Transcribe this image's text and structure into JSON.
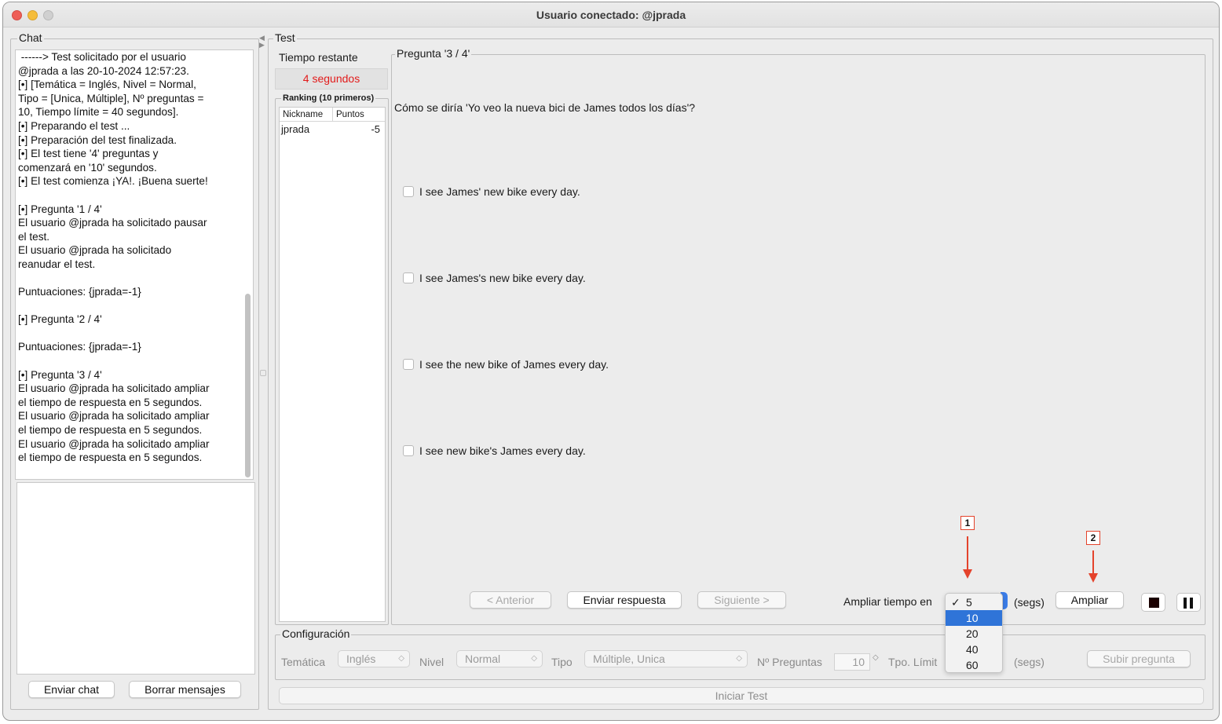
{
  "window": {
    "title": "Usuario conectado: @jprada"
  },
  "chat": {
    "legend": "Chat",
    "log": [
      " ------> Test solicitado por el usuario",
      "@jprada a las 20-10-2024 12:57:23.",
      "[•] [Temática = Inglés, Nivel = Normal,",
      "Tipo = [Unica, Múltiple], Nº preguntas =",
      "10, Tiempo límite = 40 segundos].",
      "[•] Preparando el test ...",
      "[•] Preparación del test finalizada.",
      "[•] El test tiene '4' preguntas y",
      "comenzará en '10' segundos.",
      "[•] El test comienza ¡YA!. ¡Buena suerte!",
      "",
      "[•] Pregunta '1 / 4'",
      "El usuario @jprada ha solicitado pausar",
      "el test.",
      "El usuario @jprada ha solicitado",
      "reanudar el test.",
      "",
      "Puntuaciones: {jprada=-1}",
      "",
      "[•] Pregunta '2 / 4'",
      "",
      "Puntuaciones: {jprada=-1}",
      "",
      "[•] Pregunta '3 / 4'",
      "El usuario @jprada ha solicitado ampliar",
      "el tiempo de respuesta en 5 segundos.",
      "El usuario @jprada ha solicitado ampliar",
      "el tiempo de respuesta en 5 segundos.",
      "El usuario @jprada ha solicitado ampliar",
      "el tiempo de respuesta en 5 segundos."
    ],
    "send_button": "Enviar chat",
    "clear_button": "Borrar mensajes"
  },
  "test": {
    "legend": "Test",
    "time": {
      "label": "Tiempo restante",
      "value": "4 segundos"
    },
    "ranking": {
      "title": "Ranking (10 primeros)",
      "columns": [
        "Nickname",
        "Puntos"
      ],
      "rows": [
        {
          "nickname": "jprada",
          "points": "-5"
        }
      ]
    },
    "question": {
      "legend": "Pregunta '3 / 4'",
      "text": "Cómo se diría 'Yo veo la nueva bici de James todos los días'?",
      "options": [
        "I see James' new bike every day.",
        "I see James's new bike every day.",
        "I see the new bike of James every day.",
        "I see new bike's James every day."
      ]
    },
    "nav": {
      "prev": "< Anterior",
      "send": "Enviar respuesta",
      "next": "Siguiente >"
    },
    "extend": {
      "label": "Ampliar tiempo en",
      "options": [
        "5",
        "10",
        "20",
        "40",
        "60"
      ],
      "checked": "5",
      "highlighted": "10",
      "unit": "(segs)",
      "button": "Ampliar"
    },
    "annotations": [
      "1",
      "2"
    ],
    "annotation_color": "#e4432c"
  },
  "config": {
    "legend": "Configuración",
    "tematica_label": "Temática",
    "tematica_value": "Inglés",
    "nivel_label": "Nivel",
    "nivel_value": "Normal",
    "tipo_label": "Tipo",
    "tipo_value": "Múltiple, Unica",
    "npreguntas_label": "Nº Preguntas",
    "npreguntas_value": "10",
    "tpo_label": "Tpo. Límit",
    "tpo_unit": "(segs)",
    "upload_button": "Subir pregunta",
    "start_button": "Iniciar Test"
  },
  "colors": {
    "time_red": "#e21b1b",
    "selection_blue": "#2f74d8"
  }
}
